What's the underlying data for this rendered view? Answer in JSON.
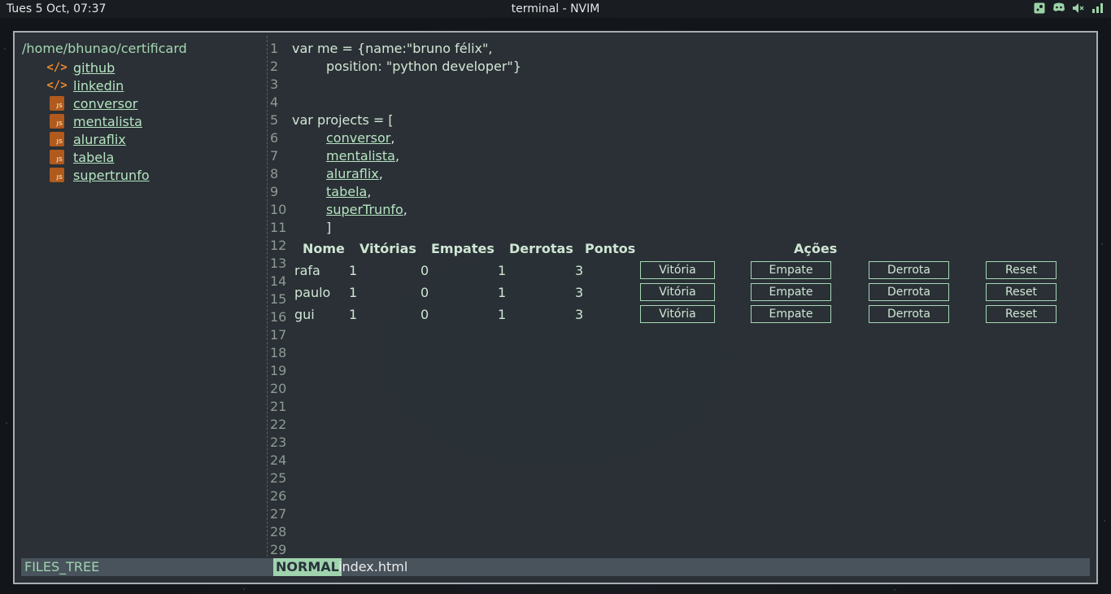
{
  "topbar": {
    "clock": "Tues 5 Oct, 07:37",
    "title": "terminal - NVIM",
    "tray_icons": [
      "steam-icon",
      "discord-icon",
      "volume-muted-icon",
      "battery-icon"
    ]
  },
  "tree": {
    "root": "/home/bhunao/certificard",
    "items": [
      {
        "label": "github",
        "icon": "code-icon"
      },
      {
        "label": "linkedin",
        "icon": "code-icon"
      },
      {
        "label": "conversor",
        "icon": "js-file-icon"
      },
      {
        "label": "mentalista",
        "icon": "js-file-icon"
      },
      {
        "label": "aluraflix",
        "icon": "js-file-icon"
      },
      {
        "label": "tabela",
        "icon": "js-file-icon"
      },
      {
        "label": "supertrunfo",
        "icon": "js-file-icon"
      }
    ]
  },
  "editor": {
    "line_numbers": [
      "1",
      "2",
      "3",
      "4",
      "5",
      "6",
      "7",
      "8",
      "9",
      "10",
      "11",
      "12",
      "13",
      "14",
      "15",
      "16",
      "17",
      "18",
      "19",
      "20",
      "21",
      "22",
      "23",
      "24",
      "25",
      "26",
      "27",
      "28",
      "29"
    ],
    "code": {
      "l1": "var me = {name:\"bruno félix\",",
      "l2": "position: \"python developer\"}",
      "l5": "var projects = [",
      "p1": "conversor",
      "p2": "mentalista",
      "p3": "aluraflix",
      "p4": "tabela",
      "p5": "superTrunfo",
      "comma": ",",
      "close": "]"
    },
    "table": {
      "headers": [
        "Nome",
        "Vitórias",
        "Empates",
        "Derrotas",
        "Pontos",
        "Ações"
      ],
      "rows": [
        {
          "name": "rafa",
          "v": "1",
          "e": "0",
          "d": "1",
          "p": "3"
        },
        {
          "name": "paulo",
          "v": "1",
          "e": "0",
          "d": "1",
          "p": "3"
        },
        {
          "name": "gui",
          "v": "1",
          "e": "0",
          "d": "1",
          "p": "3"
        }
      ],
      "buttons": [
        "Vitória",
        "Empate",
        "Derrota",
        "Reset"
      ]
    }
  },
  "statusline": {
    "left": "FILES_TREE",
    "mode": "NORMAL",
    "filename": "index.html"
  },
  "colors": {
    "accent": "#a6d7b5",
    "background": "#2c3237",
    "statusbar": "#48535c",
    "icon_orange": "#f08c2c"
  }
}
